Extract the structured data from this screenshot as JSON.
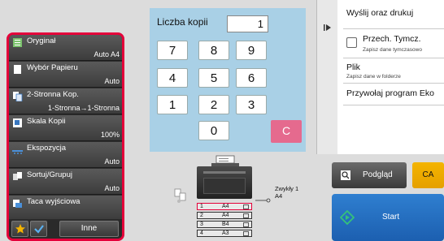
{
  "left_panel": {
    "items": [
      {
        "label": "Oryginał",
        "value": "Auto A4",
        "icon": "original-icon"
      },
      {
        "label": "Wybór Papieru",
        "value": "Auto",
        "icon": "paper-select-icon"
      },
      {
        "label": "2-Stronna Kop.",
        "value": "1-Stronna→1-Stronna",
        "icon": "duplex-icon"
      },
      {
        "label": "Skala Kopii",
        "value": "100%",
        "icon": "scale-icon"
      },
      {
        "label": "Ekspozycja",
        "value": "Auto",
        "icon": "exposure-icon"
      },
      {
        "label": "Sortuj/Grupuj",
        "value": "Auto",
        "icon": "sort-group-icon"
      },
      {
        "label": "Taca wyjściowa",
        "value": "",
        "icon": "output-tray-icon"
      }
    ],
    "bottom": {
      "favorite_icon": "star-icon",
      "check_icon": "check-icon",
      "other_label": "Inne"
    }
  },
  "keypad": {
    "copies_label": "Liczba kopii",
    "copies_value": "1",
    "keys": [
      "7",
      "8",
      "9",
      "4",
      "5",
      "6",
      "1",
      "2",
      "3",
      "0"
    ],
    "clear_label": "C"
  },
  "machine": {
    "paper_label_line1": "Zwykły 1",
    "paper_label_line2": "A4",
    "trays": [
      {
        "num": "1",
        "size": "A4"
      },
      {
        "num": "2",
        "size": "A4"
      },
      {
        "num": "3",
        "size": "B4"
      },
      {
        "num": "4",
        "size": "A3"
      }
    ]
  },
  "right_panel": {
    "send_print": "Wyślij oraz drukuj",
    "temp_save": {
      "title": "Przech. Tymcz.",
      "sub": "Zapisz dane tymczasowo"
    },
    "file": {
      "title": "Plik",
      "sub": "Zapisz dane w folderze"
    },
    "recall": "Przywołaj program Eko"
  },
  "buttons": {
    "preview": "Podgląd",
    "ca": "CA",
    "start": "Start"
  },
  "colors": {
    "highlight_border": "#e4003a",
    "keypad_bg": "#a9d0e6",
    "clear_key": "#e56a8e",
    "start": "#1c5fb0",
    "ca": "#f4b400",
    "start_icon": "#35c27a"
  }
}
